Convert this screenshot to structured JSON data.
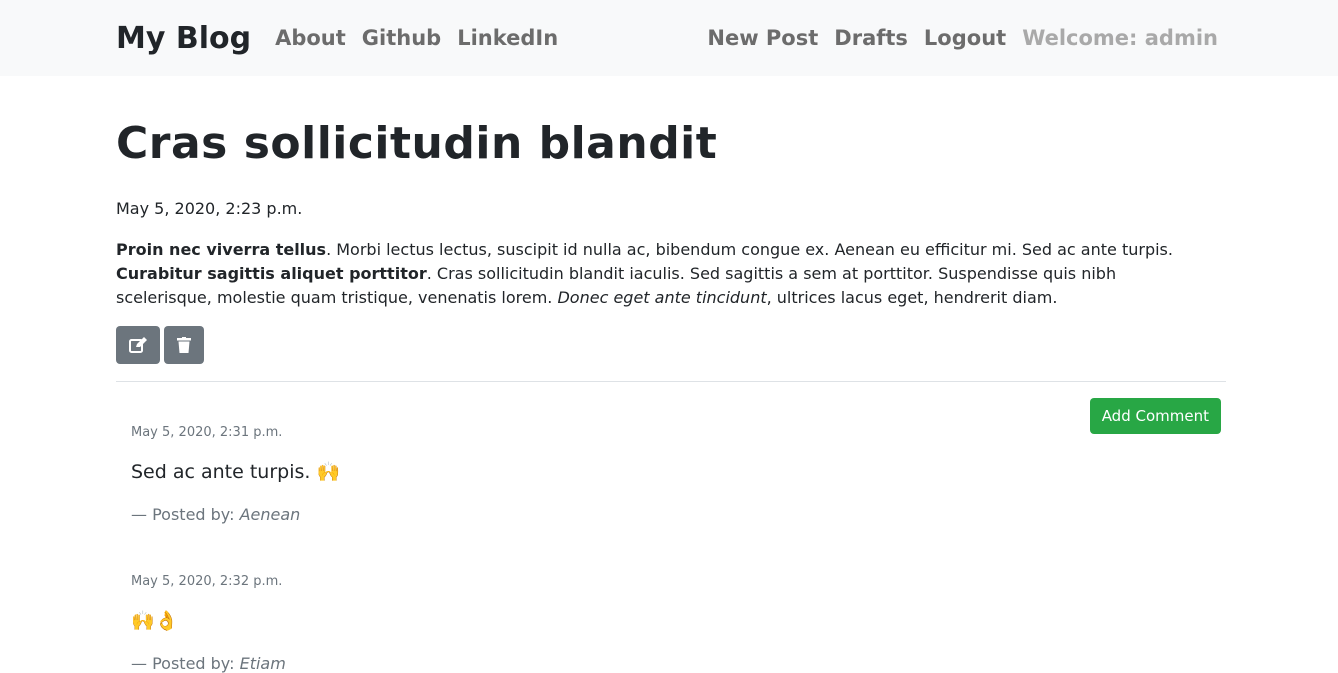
{
  "nav": {
    "brand": "My Blog",
    "left_links": [
      "About",
      "Github",
      "LinkedIn"
    ],
    "right_links": [
      "New Post",
      "Drafts",
      "Logout"
    ],
    "welcome": "Welcome: admin"
  },
  "post": {
    "title": "Cras sollicitudin blandit",
    "date": "May 5, 2020, 2:23 p.m.",
    "body": {
      "bold1": "Proin nec viverra tellus",
      "text1": ". Morbi lectus lectus, suscipit id nulla ac, bibendum congue ex. Aenean eu efficitur mi. Sed ac ante turpis. ",
      "bold2": "Curabitur sagittis aliquet porttitor",
      "text2": ". Cras sollicitudin blandit iaculis. Sed sagittis a sem at porttitor. Suspendisse quis nibh scelerisque, molestie quam tristique, venenatis lorem. ",
      "italic": "Donec eget ante tincidunt",
      "text3": ", ultrices lacus eget, hendrerit diam."
    },
    "actions": {
      "edit_icon": "edit-icon",
      "delete_icon": "trash-icon"
    }
  },
  "comments": {
    "add_label": "Add Comment",
    "items": [
      {
        "date": "May 5, 2020, 2:31 p.m.",
        "text": "Sed ac ante turpis.",
        "emoji": "🙌",
        "posted_by_prefix": "— Posted by: ",
        "author": "Aenean"
      },
      {
        "date": "May 5, 2020, 2:32 p.m.",
        "text": "",
        "emoji": "🙌👌",
        "posted_by_prefix": "— Posted by: ",
        "author": "Etiam"
      }
    ]
  }
}
